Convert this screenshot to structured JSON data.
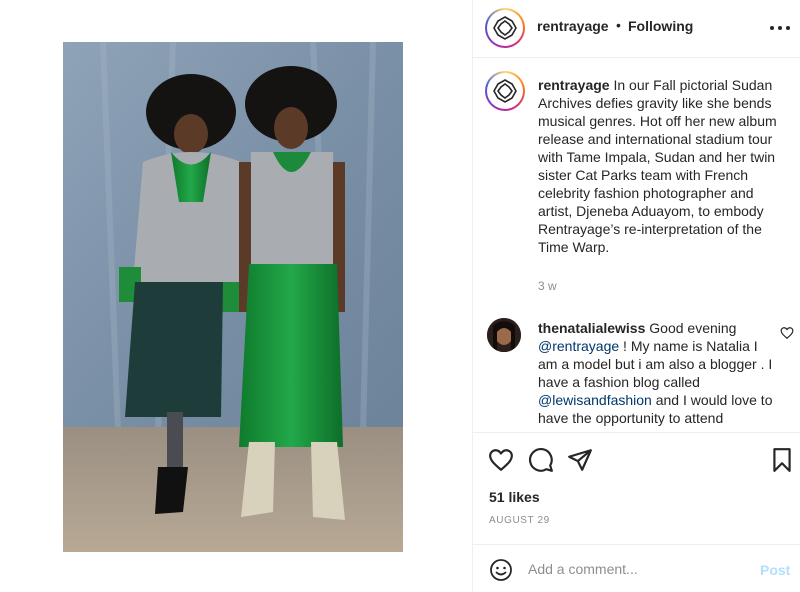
{
  "header": {
    "username": "rentrayage",
    "separator": "•",
    "follow_status": "Following",
    "more_icon": "more-horizontal-icon"
  },
  "caption": {
    "username": "rentrayage",
    "text": "In our Fall pictorial Sudan Archives defies gravity like she bends musical genres. Hot off her new album release and international stadium tour with Tame Impala, Sudan and her twin sister Cat Parks team with French celebrity fashion photographer and artist, Djeneba Aduayom, to embody Rentrayage’s re-interpretation of the Time Warp.",
    "time": "3 w"
  },
  "comment": {
    "username": "thenatalialewiss",
    "part1": "Good evening",
    "mention1": "@rentrayage",
    "part2": "! My name is Natalia I am a model but i am also a blogger . I have a fashion blog called",
    "mention2": "@lewisandfashion",
    "part3": "and I would love to have the opportunity to attend"
  },
  "actions": {
    "likes": "51 likes",
    "date": "AUGUST 29",
    "icons": [
      "heart-icon",
      "comment-icon",
      "share-icon",
      "bookmark-icon"
    ]
  },
  "add_comment": {
    "placeholder": "Add a comment...",
    "post_label": "Post"
  },
  "colors": {
    "accent_link": "#00376b",
    "post_disabled": "#b2dffc",
    "muted": "#8e8e8e"
  }
}
